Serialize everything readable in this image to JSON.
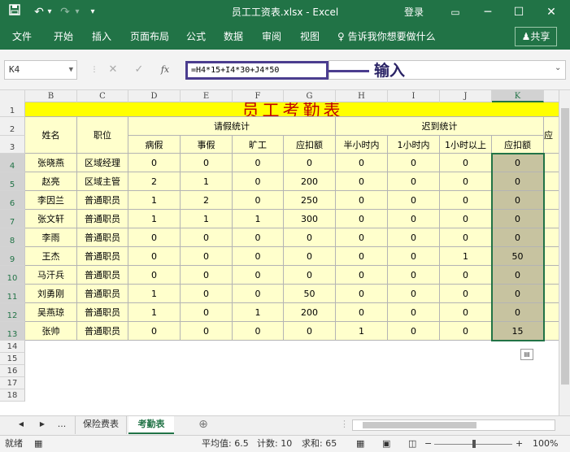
{
  "window": {
    "title": "员工工资表.xlsx - Excel",
    "login": "登录",
    "minimize": "─",
    "restore": "☐",
    "close": "✕",
    "ribbon_toggle": "▭"
  },
  "quick_access": {
    "save": "💾",
    "undo": "↶",
    "undo_dropdown": "▾",
    "redo": "↷",
    "customize": "▾"
  },
  "menu": [
    "文件",
    "开始",
    "插入",
    "页面布局",
    "公式",
    "数据",
    "审阅",
    "视图"
  ],
  "tell_me": "告诉我你想要做什么",
  "share": "共享",
  "formula_bar": {
    "name_box": "K4",
    "cancel": "✕",
    "enter": "✓",
    "fx": "fx",
    "formula": "=H4*15+I4*30+J4*50",
    "annotation": "输入"
  },
  "columns": [
    "B",
    "C",
    "D",
    "E",
    "F",
    "G",
    "H",
    "I",
    "J",
    "K"
  ],
  "rows": [
    "1",
    "2",
    "3",
    "4",
    "5",
    "6",
    "7",
    "8",
    "9",
    "10",
    "11",
    "12",
    "13",
    "14",
    "15",
    "16",
    "17",
    "18"
  ],
  "sheet": {
    "title": "员工考勤表",
    "header": {
      "name": "姓名",
      "position": "职位",
      "leave_group": "请假统计",
      "late_group": "迟到统计",
      "overflow": "应"
    },
    "subheaders": [
      "病假",
      "事假",
      "旷工",
      "应扣额",
      "半小时内",
      "1小时内",
      "1小时以上",
      "应扣额"
    ],
    "data": [
      [
        "张晓燕",
        "区域经理",
        "0",
        "0",
        "0",
        "0",
        "0",
        "0",
        "0",
        "0"
      ],
      [
        "赵亮",
        "区域主管",
        "2",
        "1",
        "0",
        "200",
        "0",
        "0",
        "0",
        "0"
      ],
      [
        "李因兰",
        "普通职员",
        "1",
        "2",
        "0",
        "250",
        "0",
        "0",
        "0",
        "0"
      ],
      [
        "张文轩",
        "普通职员",
        "1",
        "1",
        "1",
        "300",
        "0",
        "0",
        "0",
        "0"
      ],
      [
        "李雨",
        "普通职员",
        "0",
        "0",
        "0",
        "0",
        "0",
        "0",
        "0",
        "0"
      ],
      [
        "王杰",
        "普通职员",
        "0",
        "0",
        "0",
        "0",
        "0",
        "0",
        "1",
        "50"
      ],
      [
        "马汗兵",
        "普通职员",
        "0",
        "0",
        "0",
        "0",
        "0",
        "0",
        "0",
        "0"
      ],
      [
        "刘勇刚",
        "普通职员",
        "1",
        "0",
        "0",
        "50",
        "0",
        "0",
        "0",
        "0"
      ],
      [
        "吴燕琼",
        "普通职员",
        "1",
        "0",
        "1",
        "200",
        "0",
        "0",
        "0",
        "0"
      ],
      [
        "张帅",
        "普通职员",
        "0",
        "0",
        "0",
        "0",
        "1",
        "0",
        "0",
        "15"
      ]
    ]
  },
  "tabs": {
    "prev": "◀",
    "next": "▶",
    "more": "...",
    "sheet1": "保险费表",
    "sheet2": "考勤表",
    "add": "⊕"
  },
  "status": {
    "ready": "就绪",
    "average": "平均值: 6.5",
    "count": "计数: 10",
    "sum": "求和: 65",
    "zoom": "100%",
    "zoom_minus": "−",
    "zoom_plus": "+"
  },
  "colors": {
    "ribbon": "#217346",
    "title_fill": "#ffff00",
    "title_text": "#c00000",
    "table_fill": "#ffffcc",
    "selection_fill": "#c7c3a0",
    "annotation": "#4b3d8f"
  }
}
